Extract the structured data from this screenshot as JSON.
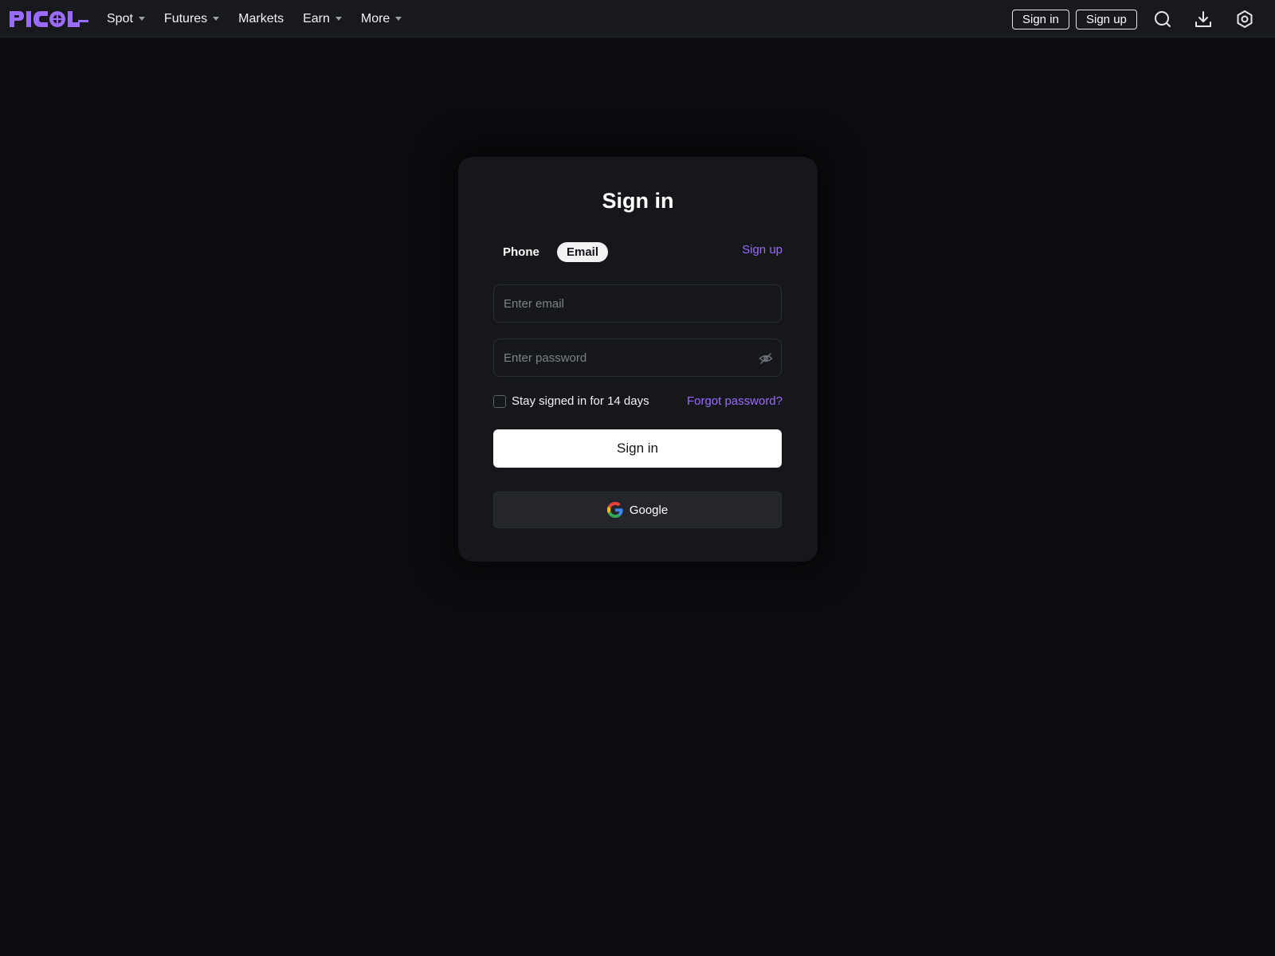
{
  "header": {
    "logo_text": "PICOL",
    "nav": [
      {
        "label": "Spot",
        "has_caret": true
      },
      {
        "label": "Futures",
        "has_caret": true
      },
      {
        "label": "Markets",
        "has_caret": false
      },
      {
        "label": "Earn",
        "has_caret": true
      },
      {
        "label": "More",
        "has_caret": true
      }
    ],
    "signin_label": "Sign in",
    "signup_label": "Sign up",
    "icons": [
      "search-icon",
      "download-icon",
      "settings-icon"
    ]
  },
  "form": {
    "title": "Sign in",
    "tabs": [
      {
        "label": "Phone",
        "active": false
      },
      {
        "label": "Email",
        "active": true
      }
    ],
    "signup_link": "Sign up",
    "email_placeholder": "Enter email",
    "email_value": "",
    "password_placeholder": "Enter password",
    "password_value": "",
    "remember_label": "Stay signed in for 14 days",
    "remember_checked": false,
    "forgot_label": "Forgot password?",
    "submit_label": "Sign in",
    "google_label": "Google"
  },
  "colors": {
    "background": "#0b0d10",
    "header": "#17191d",
    "card": "#15171b",
    "accent": "#9a6bff"
  }
}
